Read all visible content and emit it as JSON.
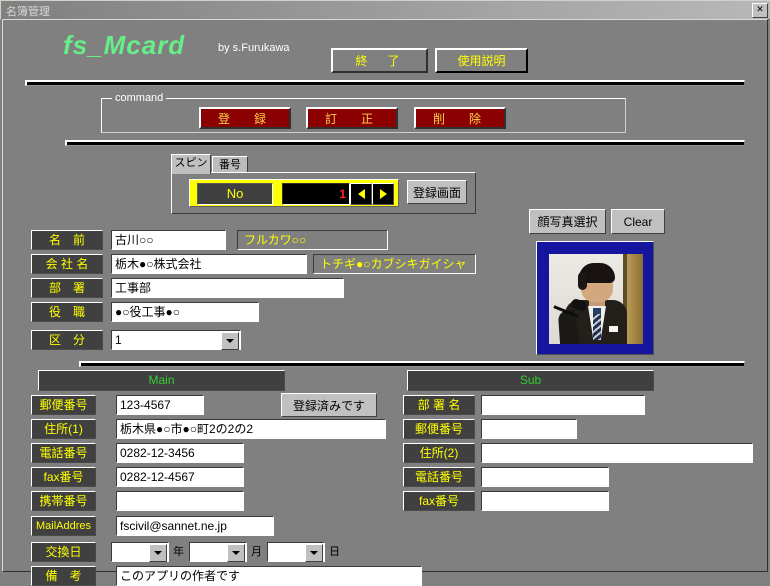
{
  "window": {
    "title": "名簿管理",
    "close_label": "✕"
  },
  "header": {
    "app_title": "fs_Mcard",
    "author": "by s.Furukawa",
    "exit_button": "終　了",
    "help_button": "使用説明"
  },
  "command": {
    "legend": "command",
    "register_button": "登　録",
    "correct_button": "訂　正",
    "delete_button": "削　除"
  },
  "tabs": [
    {
      "label": "スピン",
      "active": true
    },
    {
      "label": "番号",
      "active": false
    }
  ],
  "spin": {
    "no_label": "No",
    "no_value": "1",
    "prev_icon": "triangle-left-icon",
    "next_icon": "triangle-right-icon",
    "screen_button": "登録画面"
  },
  "photo": {
    "select_button": "顔写真選択",
    "clear_button": "Clear",
    "image_alt": "portrait-photo"
  },
  "person": [
    {
      "label": "名　前",
      "value": "古川○○",
      "kana": "フルカワ○○"
    },
    {
      "label": "会 社 名",
      "value": "栃木●○株式会社",
      "kana": "トチギ●○カブシキガイシャ"
    },
    {
      "label": "部　署",
      "value": "工事部",
      "kana": ""
    },
    {
      "label": "役　職",
      "value": "●○役工事●○",
      "kana": ""
    }
  ],
  "category": {
    "label": "区　分",
    "value": "1"
  },
  "main": {
    "header": "Main",
    "status_button": "登録済みです",
    "fields": [
      {
        "label": "郵便番号",
        "value": "123-4567"
      },
      {
        "label": "住所(1)",
        "value": "栃木県●○市●○町2の2の2"
      },
      {
        "label": "電話番号",
        "value": "0282-12-3456"
      },
      {
        "label": "fax番号",
        "value": "0282-12-4567"
      },
      {
        "label": "携帯番号",
        "value": ""
      },
      {
        "label": "MailAddres",
        "value": "fscivil@sannet.ne.jp"
      }
    ],
    "date": {
      "label": "交換日",
      "year_value": "",
      "year_unit": "年",
      "month_value": "",
      "month_unit": "月",
      "day_value": "",
      "day_unit": "日"
    },
    "note": {
      "label": "備　考",
      "value": "このアプリの作者です"
    }
  },
  "sub": {
    "header": "Sub",
    "fields": [
      {
        "label": "部 署 名",
        "value": ""
      },
      {
        "label": "郵便番号",
        "value": ""
      },
      {
        "label": "住所(2)",
        "value": ""
      },
      {
        "label": "電話番号",
        "value": ""
      },
      {
        "label": "fax番号",
        "value": ""
      }
    ]
  },
  "colors": {
    "face": "#808080",
    "label_bg": "#404040",
    "label_fg": "#ffff00",
    "accent_green": "#33cc33",
    "command_red": "#8b0000",
    "spin_yellow": "#ffff00",
    "photo_frame": "#1515a0"
  }
}
